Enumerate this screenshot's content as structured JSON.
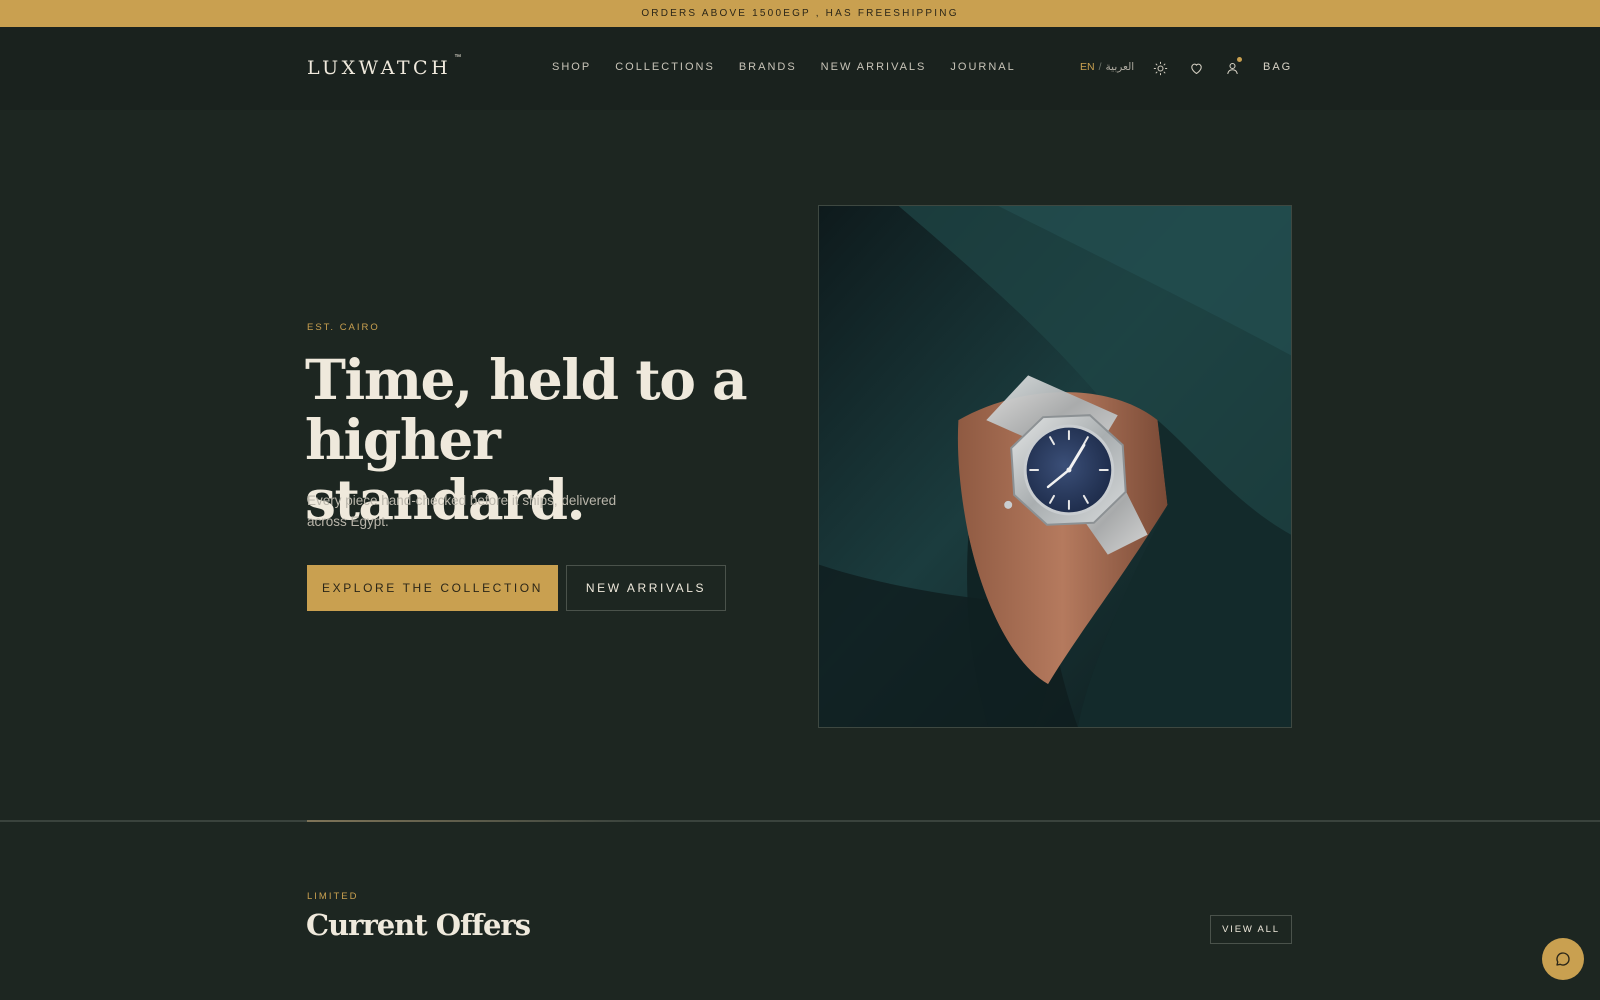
{
  "announcement": {
    "text": "ORDERS ABOVE 1500EGP , HAS FREESHIPPING"
  },
  "header": {
    "logo": "LUXWATCH",
    "logo_tm": "™",
    "nav": [
      "SHOP",
      "COLLECTIONS",
      "BRANDS",
      "NEW ARRIVALS",
      "JOURNAL"
    ],
    "lang_en": "EN",
    "lang_sep": "/",
    "lang_ar": "العربية",
    "icons": [
      "sun-icon",
      "heart-icon",
      "user-icon"
    ],
    "bag_label": "BAG"
  },
  "hero": {
    "eyebrow": "EST. CAIRO",
    "headline_line1": "Time, held to a",
    "headline_line2": "higher standard.",
    "subtext": "Every piece hand-checked before it ships, delivered across Egypt.",
    "primary_cta": "EXPLORE THE COLLECTION",
    "secondary_cta": "NEW ARRIVALS"
  },
  "offers": {
    "eyebrow": "LIMITED",
    "title": "Current Offers",
    "view_all": "VIEW ALL"
  },
  "colors": {
    "accent": "#c9a050",
    "background": "#1d2621",
    "header_bg": "#1a221e",
    "text": "#efe9dc"
  }
}
